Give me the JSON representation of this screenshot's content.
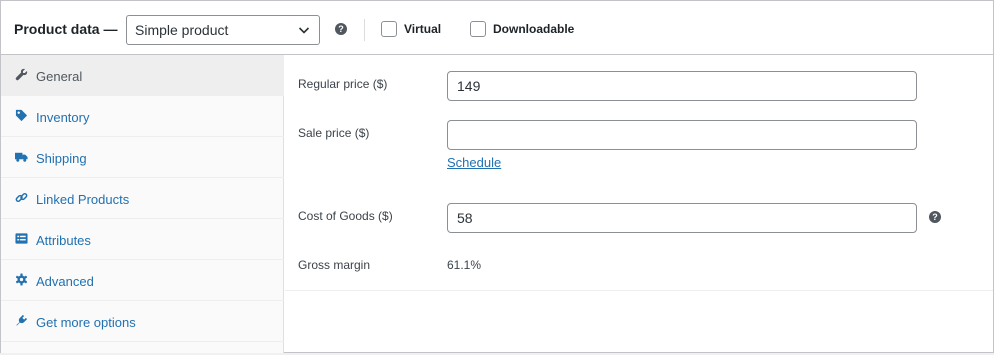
{
  "header": {
    "title": "Product data —",
    "product_type": "Simple product",
    "help": "?",
    "virtual_label": "Virtual",
    "downloadable_label": "Downloadable"
  },
  "tabs": [
    {
      "label": "General",
      "icon": "wrench-icon",
      "active": true
    },
    {
      "label": "Inventory",
      "icon": "tag-icon",
      "active": false
    },
    {
      "label": "Shipping",
      "icon": "truck-icon",
      "active": false
    },
    {
      "label": "Linked Products",
      "icon": "link-icon",
      "active": false
    },
    {
      "label": "Attributes",
      "icon": "list-icon",
      "active": false
    },
    {
      "label": "Advanced",
      "icon": "gear-icon",
      "active": false
    },
    {
      "label": "Get more options",
      "icon": "plugin-icon",
      "active": false
    }
  ],
  "fields": {
    "regular_price_label": "Regular price ($)",
    "regular_price_value": "149",
    "sale_price_label": "Sale price ($)",
    "sale_price_value": "",
    "schedule_link": "Schedule",
    "cost_label": "Cost of Goods ($)",
    "cost_value": "58",
    "cost_help": "?",
    "gross_margin_label": "Gross margin",
    "gross_margin_value": "61.1%"
  },
  "colors": {
    "link": "#2271b1",
    "border": "#c3c4c7",
    "tab_bg": "#fafafa",
    "tab_active_bg": "#eeeeee"
  }
}
